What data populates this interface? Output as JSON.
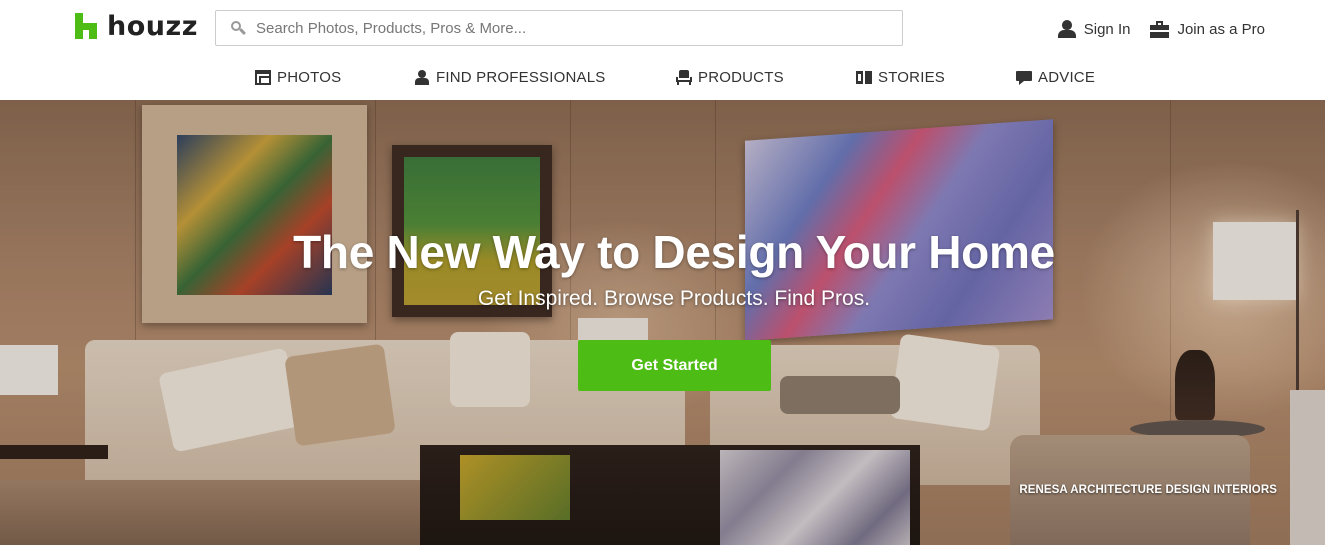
{
  "brand": {
    "name": "houzz",
    "accent": "#4dbc15"
  },
  "search": {
    "placeholder": "Search Photos, Products, Pros & More...",
    "value": ""
  },
  "auth": {
    "sign_in": "Sign In",
    "join_pro": "Join as a Pro"
  },
  "nav": {
    "items": [
      {
        "label": "PHOTOS",
        "icon": "photos-icon"
      },
      {
        "label": "FIND PROFESSIONALS",
        "icon": "professional-icon"
      },
      {
        "label": "PRODUCTS",
        "icon": "chair-icon"
      },
      {
        "label": "STORIES",
        "icon": "book-icon"
      },
      {
        "label": "ADVICE",
        "icon": "speech-bubble-icon"
      }
    ]
  },
  "hero": {
    "title": "The New Way to Design Your Home",
    "subtitle": "Get Inspired. Browse Products. Find Pros.",
    "cta_label": "Get Started",
    "photo_credit": "RENESA ARCHITECTURE DESIGN INTERIORS"
  }
}
